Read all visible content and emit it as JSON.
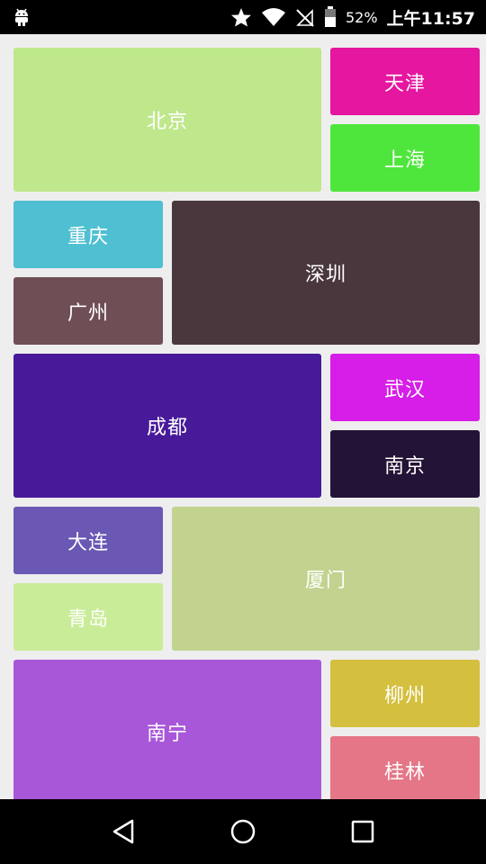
{
  "status_bar": {
    "icons": [
      "android-debug-icon",
      "star-icon",
      "wifi-icon",
      "no-signal-icon",
      "battery-icon"
    ],
    "battery_percent": "52%",
    "time": "上午11:57"
  },
  "tiles": [
    {
      "label": "北京",
      "color": "#bfe78b"
    },
    {
      "label": "天津",
      "color": "#e5169f"
    },
    {
      "label": "上海",
      "color": "#4ee63c"
    },
    {
      "label": "重庆",
      "color": "#4fbfd2"
    },
    {
      "label": "深圳",
      "color": "#4a373e"
    },
    {
      "label": "广州",
      "color": "#6f4e56"
    },
    {
      "label": "成都",
      "color": "#471a99"
    },
    {
      "label": "武汉",
      "color": "#d61ee8"
    },
    {
      "label": "南京",
      "color": "#231336"
    },
    {
      "label": "大连",
      "color": "#6b57b4"
    },
    {
      "label": "厦门",
      "color": "#c1d38f"
    },
    {
      "label": "青岛",
      "color": "#c9ec98"
    },
    {
      "label": "南宁",
      "color": "#a957d9"
    },
    {
      "label": "柳州",
      "color": "#d5bf3e"
    },
    {
      "label": "桂林",
      "color": "#e57687"
    }
  ],
  "nav_bar": {
    "icons": [
      "back-icon",
      "home-icon",
      "recents-icon"
    ]
  }
}
